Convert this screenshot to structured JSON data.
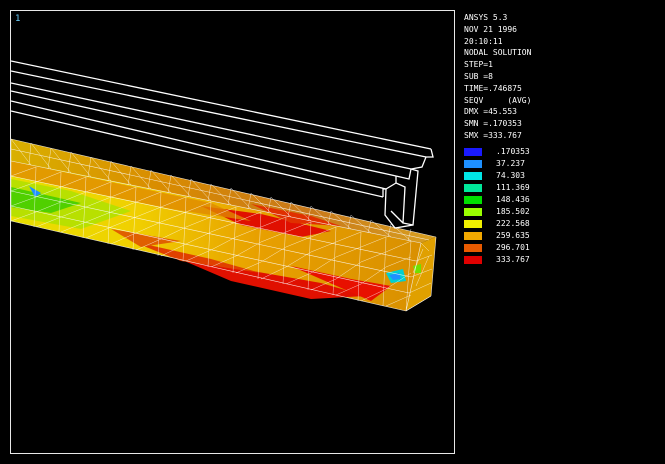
{
  "viewport": {
    "window_number": "1"
  },
  "info": {
    "lines": [
      "ANSYS 5.3",
      "NOV 21 1996",
      "20:10:11",
      "NODAL SOLUTION",
      "STEP=1",
      "SUB =8",
      "TIME=.746875",
      "SEQV     (AVG)",
      "DMX =45.553",
      "SMN =.170353",
      "SMX =333.767"
    ]
  },
  "legend": {
    "entries": [
      {
        "value": ".170353",
        "color": "#1a1aff"
      },
      {
        "value": "37.237",
        "color": "#1e90ff"
      },
      {
        "value": "74.303",
        "color": "#00e5e5"
      },
      {
        "value": "111.369",
        "color": "#00e89a"
      },
      {
        "value": "148.436",
        "color": "#00e000"
      },
      {
        "value": "185.502",
        "color": "#9aff00"
      },
      {
        "value": "222.568",
        "color": "#f0f000"
      },
      {
        "value": "259.635",
        "color": "#f2a800"
      },
      {
        "value": "296.701",
        "color": "#e85a00"
      },
      {
        "value": "333.767",
        "color": "#e00000"
      }
    ]
  },
  "colors": {
    "background": "#000000",
    "frame": "#e8e8e8",
    "mesh": "#ffffff",
    "window_number": "#6fd3ff"
  }
}
